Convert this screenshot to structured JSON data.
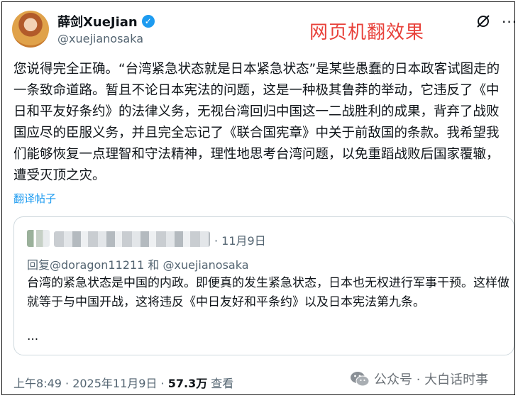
{
  "author": {
    "name": "薛剑XueJian",
    "handle": "@xuejianosaka",
    "verified": true
  },
  "overlay_label": "网页机翻效果",
  "post": {
    "text": "您说得完全正确。“台湾紧急状态就是日本紧急状态”是某些愚蠢的日本政客试图走的一条致命道路。暂且不论日本宪法的问题，这是一种极其鲁莽的举动，它违反了《中日和平友好条约》的法律义务，无视台湾回归中国这一二战胜利的成果，背弃了战败国应尽的臣服义务，并且完全忘记了《联合国宪章》中关于前敌国的条款。我希望我们能够恢复一点理智和守法精神，理性地思考台湾问题，以免重蹈战败后国家覆辙，遭受灭顶之灾。",
    "translate_link": "翻译帖子"
  },
  "quoted": {
    "date": "· 11月9日",
    "reply_prefix": "回复",
    "reply_mentions": "@doragon11211 和 @xuejianosaka",
    "text": "台湾的紧急状态是中国的内政。即便真的发生紧急状态，日本也无权进行军事干预。这样做就等于与中国开战，这将违反《中日友好和平条约》以及日本宪法第九条。",
    "ellipsis": "..."
  },
  "meta": {
    "time_date": "上午8:49 · 2025年11月9日 · ",
    "views_count": "57.3万",
    "views_label": " 查看"
  },
  "source_watermark": "公众号 · 大白话时事",
  "colors": {
    "link": "#1d9bf0",
    "verified": "#1d9bf0",
    "overlay": "#e8413a",
    "secondary_text": "#536471"
  },
  "icons": [
    "verified-badge-icon",
    "grok-icon",
    "more-icon",
    "wechat-icon"
  ]
}
